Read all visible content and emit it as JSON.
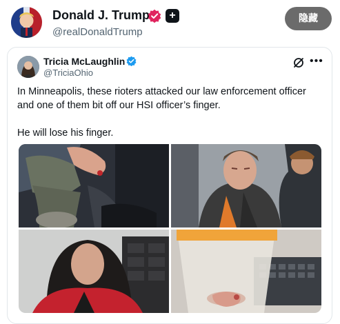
{
  "post": {
    "author_name": "Donald J. Trump",
    "author_handle": "@realDonaldTrump",
    "hide_label": "隐藏"
  },
  "quote": {
    "author_name": "Tricia McLaughlin",
    "author_handle": "@TriciaOhio",
    "text_paragraph_1": "In Minneapolis, these rioters attacked our law enforcement officer and one of them bit off our HSI officer’s finger.",
    "text_paragraph_2": "He will lose his finger.",
    "media_count": 4
  },
  "icons": {
    "verified_pink": "verified-badge-icon",
    "plus_badge": "plus-icon",
    "verified_blue": "verified-badge-icon",
    "grok": "grok-icon",
    "more": "more-options-icon"
  },
  "colors": {
    "hide_button_bg": "#6b6b6b",
    "verified_pink": "#e0245e",
    "verified_blue": "#1d9bf0",
    "text_primary": "#0f1419",
    "text_secondary": "#536471"
  }
}
